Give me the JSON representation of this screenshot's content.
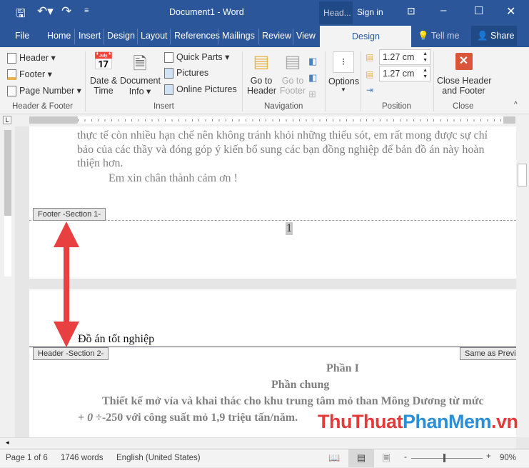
{
  "title_bar": {
    "doc_title": "Document1  -  Word",
    "context_tab": "Head...",
    "sign_in": "Sign in"
  },
  "tabs": [
    "File",
    "Home",
    "Insert",
    "Design",
    "Layout",
    "References",
    "Mailings",
    "Review",
    "View"
  ],
  "active_tab": "Design",
  "tell_me": "Tell me",
  "share": "Share",
  "ribbon": {
    "header": "Header",
    "footer": "Footer",
    "page_number": "Page Number",
    "group_hf": "Header & Footer",
    "date_time_1": "Date &",
    "date_time_2": "Time",
    "doc_info_1": "Document",
    "doc_info_2": "Info",
    "quick_parts": "Quick Parts",
    "pictures": "Pictures",
    "online_pictures": "Online Pictures",
    "group_insert": "Insert",
    "go_header_1": "Go to",
    "go_header_2": "Header",
    "go_footer_1": "Go to",
    "go_footer_2": "Footer",
    "group_nav": "Navigation",
    "options": "Options",
    "header_pos": "1.27 cm",
    "footer_pos": "1.27 cm",
    "group_pos": "Position",
    "close_1": "Close Header",
    "close_2": "and Footer",
    "group_close": "Close"
  },
  "document": {
    "p1_lines": [
      "thực tế còn nhiều hạn chế nên không tránh khỏi những thiếu sót, em rất mong được sự chỉ",
      "bảo của các thầy và đóng góp ý kiến bổ sung các bạn đồng nghiệp để bản đồ án này hoàn",
      "thiện hơn."
    ],
    "thanks": "Em xin chân thành cảm ơn !",
    "footer_tag": "Footer -Section 1-",
    "page_number": "1",
    "header_text": "Đồ án tốt nghiệp",
    "header_tag": "Header -Section 2-",
    "same_as_prev": "Same as Previous",
    "heading1": "Phần I",
    "heading2": "Phần chung",
    "body1": "Thiết kế mở vỉa và khai thác cho khu trung tâm mỏ than Mông Dương từ mức",
    "body2_prefix": "+ ",
    "body2_italic": "0",
    "body2_rest": " ÷-250 với công suất mỏ 1,9 triệu tấn/năm."
  },
  "status": {
    "page": "Page 1 of 6",
    "words": "1746 words",
    "language": "English (United States)",
    "zoom": "90%"
  },
  "watermark": {
    "part1": "ThuThuat",
    "part2": "PhanMem",
    "part3": ".vn"
  }
}
